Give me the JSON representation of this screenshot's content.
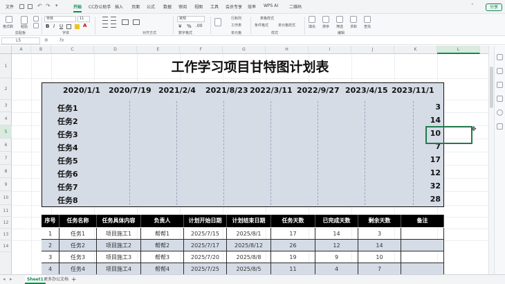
{
  "ribbon": {
    "tabs": [
      "文件",
      "开始",
      "CC办公助手",
      "插入",
      "页面",
      "公式",
      "数据",
      "审阅",
      "视图",
      "工具",
      "会员专享",
      "效率",
      "WPS AI",
      "二维码"
    ],
    "active_tab": "开始",
    "share_label": "分享"
  },
  "toolbar": {
    "format_painter": "格式刷",
    "paste": "粘贴",
    "clipboard_group": "剪贴板",
    "font_name": "宋体",
    "font_size": "11",
    "font_group": "字体",
    "align_group": "对齐方式",
    "number_format": "常规",
    "number_group": "数字格式",
    "cond_format": "条件格式",
    "table_style": "表格样式",
    "cell_style": "单元格样式",
    "style_group": "样式",
    "row_col": "行和列",
    "worksheet": "工作表",
    "cells_group": "单元格",
    "fill": "填充",
    "sort": "排序",
    "filter": "筛选",
    "sum": "求和",
    "find": "查找",
    "edit_group": "编辑"
  },
  "formula_bar": {
    "cell_ref": "L5",
    "fx": "fx",
    "formula": ""
  },
  "columns": [
    "A",
    "B",
    "C",
    "D",
    "E",
    "F",
    "G",
    "H",
    "I",
    "J",
    "K",
    "L"
  ],
  "selected_column": "L",
  "rows": [
    "1",
    "2",
    "3",
    "4",
    "5",
    "6",
    "7",
    "8",
    "9",
    "10",
    "11",
    "12",
    "13",
    "14"
  ],
  "selected_row": "5",
  "sheet_title": "工作学习项目甘特图计划表",
  "gantt": {
    "dates": [
      "2020/1/1",
      "2020/7/19",
      "2021/2/4",
      "2021/8/23",
      "2022/3/11",
      "2022/9/27",
      "2023/4/15",
      "2023/11/1"
    ],
    "tasks": [
      {
        "name": "任务1",
        "value": "3"
      },
      {
        "name": "任务2",
        "value": "14"
      },
      {
        "name": "任务3",
        "value": "10"
      },
      {
        "name": "任务4",
        "value": "7"
      },
      {
        "name": "任务5",
        "value": "17"
      },
      {
        "name": "任务6",
        "value": "12"
      },
      {
        "name": "任务7",
        "value": "32"
      },
      {
        "name": "任务8",
        "value": "28"
      }
    ]
  },
  "table": {
    "headers": [
      "序号",
      "任务名称",
      "任务具体内容",
      "负责人",
      "计划开始日期",
      "计划结束日期",
      "任务天数",
      "已完成天数",
      "剩余天数",
      "备注"
    ],
    "rows": [
      [
        "1",
        "任务1",
        "项目施工1",
        "帮帮1",
        "2025/7/15",
        "2025/8/1",
        "17",
        "14",
        "3",
        ""
      ],
      [
        "2",
        "任务2",
        "项目施工2",
        "帮帮2",
        "2025/7/17",
        "2025/8/12",
        "26",
        "12",
        "14",
        ""
      ],
      [
        "3",
        "任务3",
        "项目施工3",
        "帮帮3",
        "2025/7/20",
        "2025/8/8",
        "19",
        "9",
        "10",
        ""
      ],
      [
        "4",
        "任务4",
        "项目施工4",
        "帮帮4",
        "2025/7/25",
        "2025/8/5",
        "11",
        "4",
        "7",
        ""
      ]
    ]
  },
  "sheet_tabs": [
    "Sheet1",
    "更多办公文档"
  ],
  "active_sheet": "Sheet1",
  "add_sheet": "+",
  "colors": {
    "accent": "#0e8a4f",
    "gantt_bg": "#d6dce6",
    "header_bg": "#000000"
  }
}
